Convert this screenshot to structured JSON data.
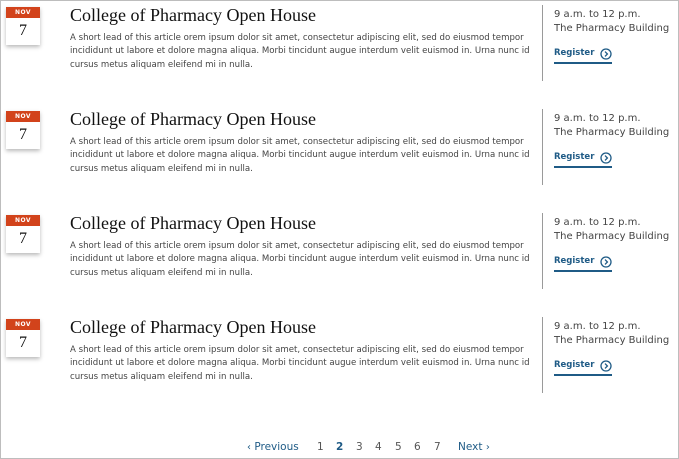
{
  "events": [
    {
      "month": "NOV",
      "day": "7",
      "title": "College of Pharmacy Open House",
      "lead": "A short lead of this article orem ipsum dolor sit amet, consectetur adipiscing elit, sed do eiusmod tempor incididunt ut labore et dolore magna aliqua. Morbi tincidunt augue interdum velit euismod in. Urna nunc id cursus metus aliquam eleifend mi in nulla.",
      "time": "9 a.m. to 12 p.m.",
      "location": "The Pharmacy Building",
      "register_label": "Register",
      "register_icon": "circle-chevron-right-icon"
    },
    {
      "month": "NOV",
      "day": "7",
      "title": "College of Pharmacy Open House",
      "lead": "A short lead of this article orem ipsum dolor sit amet, consectetur adipiscing elit, sed do eiusmod tempor incididunt ut labore et dolore magna aliqua. Morbi tincidunt augue interdum velit euismod in. Urna nunc id cursus metus aliquam eleifend mi in nulla.",
      "time": "9 a.m. to 12 p.m.",
      "location": "The Pharmacy Building",
      "register_label": "Register",
      "register_icon": "circle-chevron-right-icon"
    },
    {
      "month": "NOV",
      "day": "7",
      "title": "College of Pharmacy Open House",
      "lead": "A short lead of this article orem ipsum dolor sit amet, consectetur adipiscing elit, sed do eiusmod tempor incididunt ut labore et dolore magna aliqua. Morbi tincidunt augue interdum velit euismod in. Urna nunc id cursus metus aliquam eleifend mi in nulla.",
      "time": "9 a.m. to 12 p.m.",
      "location": "The Pharmacy Building",
      "register_label": "Register",
      "register_icon": "circle-chevron-right-icon"
    },
    {
      "month": "NOV",
      "day": "7",
      "title": "College of Pharmacy Open House",
      "lead": "A short lead of this article orem ipsum dolor sit amet, consectetur adipiscing elit, sed do eiusmod tempor incididunt ut labore et dolore magna aliqua. Morbi tincidunt augue interdum velit euismod in. Urna nunc id cursus metus aliquam eleifend mi in nulla.",
      "time": "9 a.m. to 12 p.m.",
      "location": "The Pharmacy Building",
      "register_label": "Register",
      "register_icon": "circle-chevron-right-icon"
    }
  ],
  "pagination": {
    "previous_label": "Previous",
    "next_label": "Next",
    "pages": [
      "1",
      "2",
      "3",
      "4",
      "5",
      "6",
      "7"
    ],
    "current_page": "2"
  },
  "colors": {
    "month_band": "#d2431b",
    "accent": "#1f5b86"
  }
}
